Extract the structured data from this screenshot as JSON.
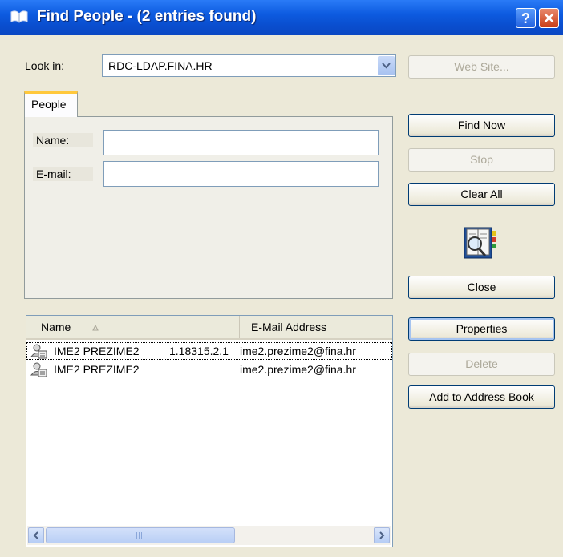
{
  "window": {
    "title": "Find People - (2 entries found)",
    "help_label": "?",
    "close_label": "✕"
  },
  "look_in": {
    "label": "Look in:",
    "value": "RDC-LDAP.FINA.HR"
  },
  "buttons": {
    "web_site": "Web Site...",
    "find_now": "Find Now",
    "stop": "Stop",
    "clear_all": "Clear All",
    "close": "Close",
    "properties": "Properties",
    "delete": "Delete",
    "add_to_address_book": "Add to Address Book"
  },
  "tabs": [
    "People"
  ],
  "fields": {
    "name_label": "Name:",
    "name_value": "",
    "email_label": "E-mail:",
    "email_value": ""
  },
  "results": {
    "columns": [
      "Name",
      "E-Mail Address"
    ],
    "rows": [
      {
        "name": "IME2 PREZIME2",
        "id": "1.18315.2.1",
        "email": "ime2.prezime2@fina.hr"
      },
      {
        "name": "IME2 PREZIME2",
        "id": "",
        "email": "ime2.prezime2@fina.hr"
      }
    ]
  }
}
